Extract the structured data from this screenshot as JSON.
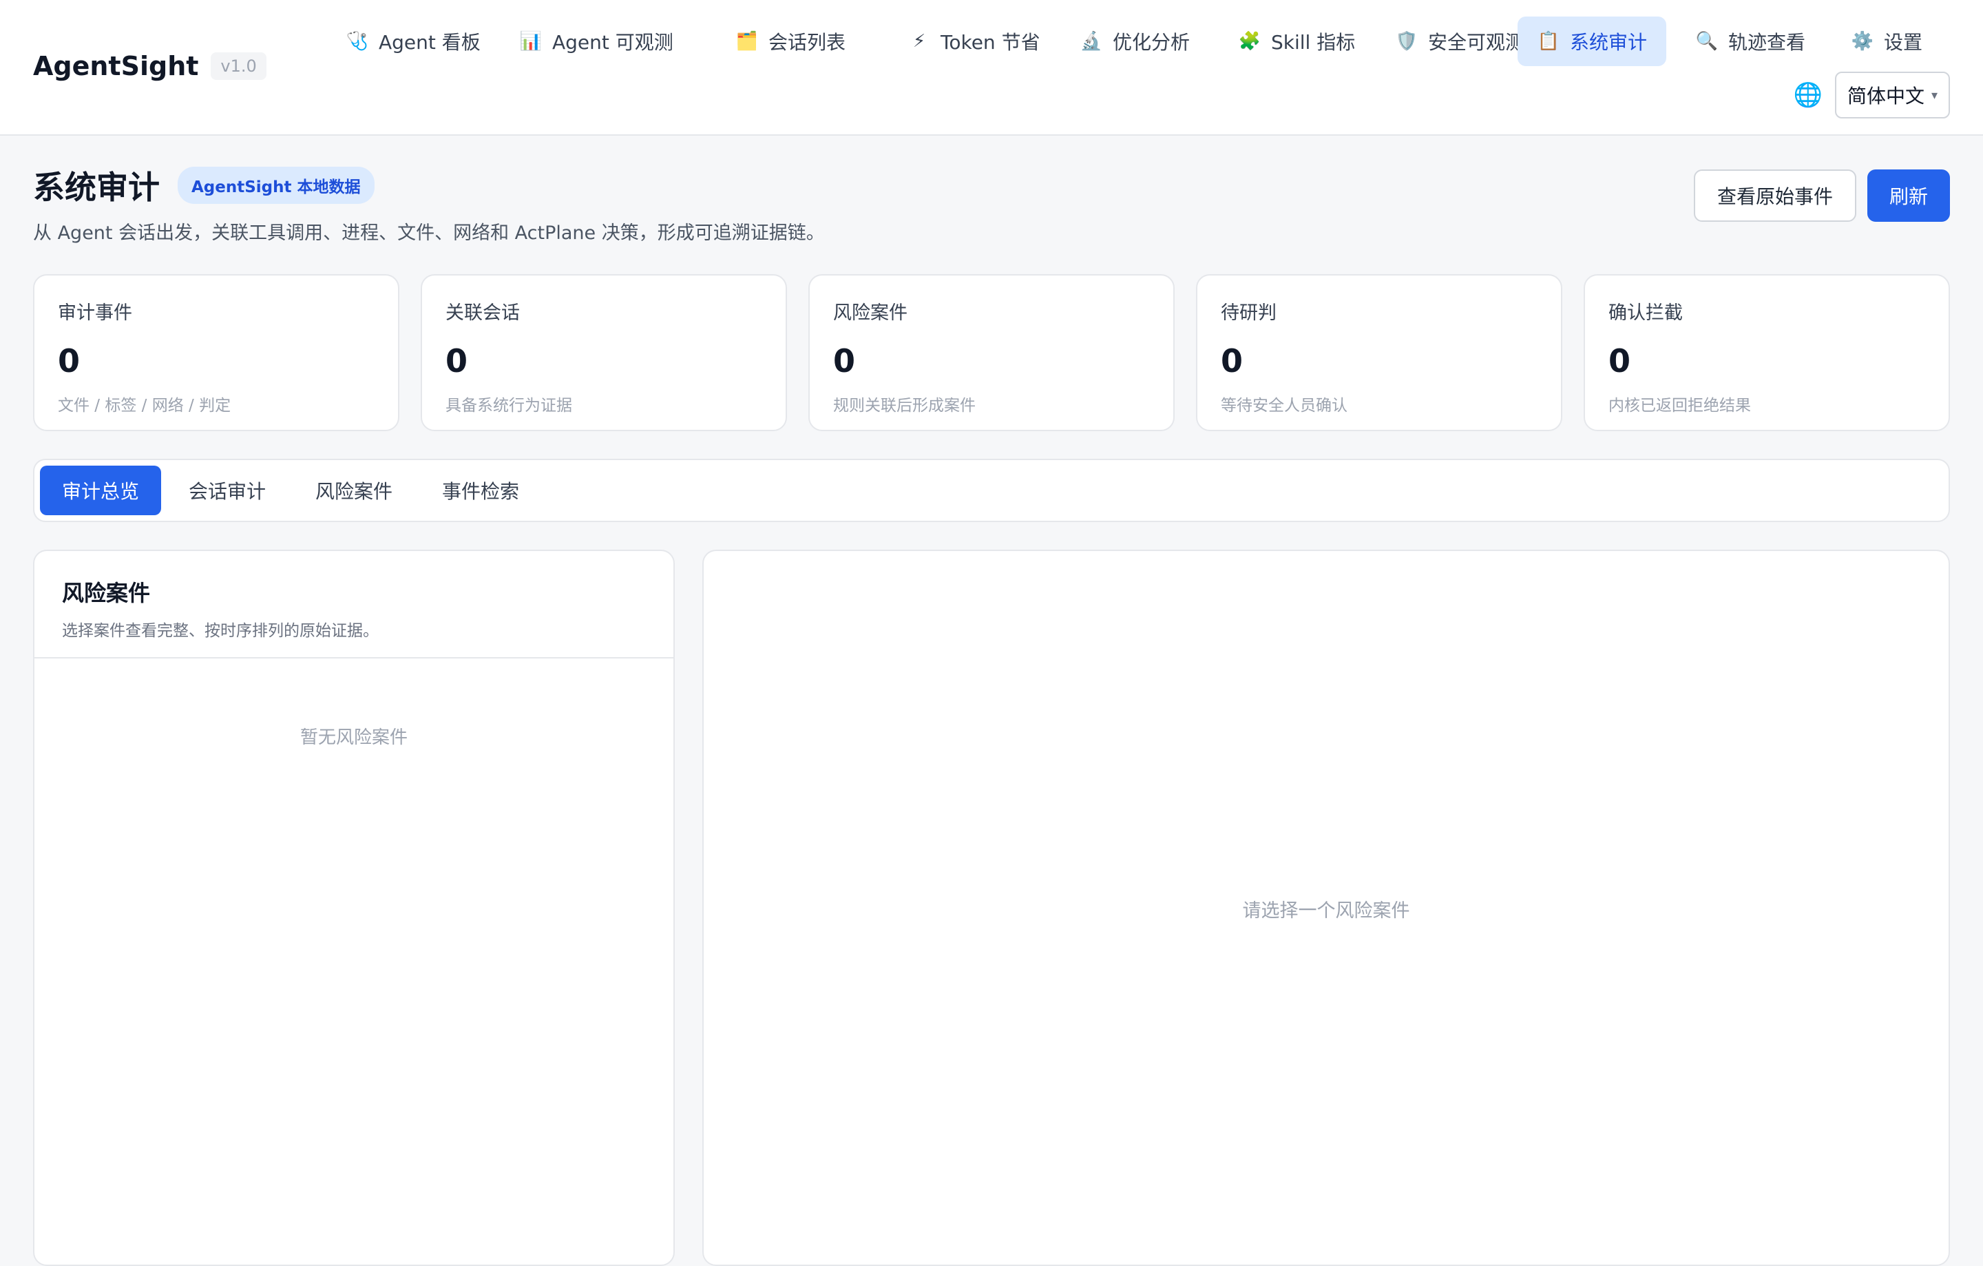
{
  "app": {
    "name": "AgentSight",
    "version": "v1.0"
  },
  "nav": {
    "items": [
      {
        "label": "Agent 看板",
        "icon": "🩺",
        "icon_name": "stethoscope-icon"
      },
      {
        "label": "Agent 可观测",
        "icon": "📊",
        "icon_name": "bar-chart-icon"
      },
      {
        "label": "会话列表",
        "icon": "🗂️",
        "icon_name": "card-index-dividers-icon"
      },
      {
        "label": "Token 节省",
        "icon": "⚡",
        "icon_name": "lightning-icon"
      },
      {
        "label": "优化分析",
        "icon": "🔬",
        "icon_name": "microscope-icon"
      },
      {
        "label": "Skill 指标",
        "icon": "🧩",
        "icon_name": "puzzle-icon"
      },
      {
        "label": "安全可观测",
        "icon": "🛡️",
        "icon_name": "shield-icon"
      },
      {
        "label": "系统审计",
        "icon": "📋",
        "icon_name": "clipboard-icon"
      },
      {
        "label": "轨迹查看",
        "icon": "🔍",
        "icon_name": "magnifier-icon"
      },
      {
        "label": "设置",
        "icon": "⚙️",
        "icon_name": "gear-icon"
      }
    ],
    "active_index": 7
  },
  "language": {
    "icon": "🌐",
    "icon_name": "globe-icon",
    "selected": "简体中文",
    "caret": "▾"
  },
  "page": {
    "title": "系统审计",
    "badge": "AgentSight 本地数据",
    "subtitle": "从 Agent 会话出发，关联工具调用、进程、文件、网络和 ActPlane 决策，形成可追溯证据链。",
    "actions": {
      "raw_events": "查看原始事件",
      "refresh": "刷新"
    }
  },
  "stats": [
    {
      "label": "审计事件",
      "value": "0",
      "desc": "文件 / 标签 / 网络 / 判定"
    },
    {
      "label": "关联会话",
      "value": "0",
      "desc": "具备系统行为证据"
    },
    {
      "label": "风险案件",
      "value": "0",
      "desc": "规则关联后形成案件"
    },
    {
      "label": "待研判",
      "value": "0",
      "desc": "等待安全人员确认"
    },
    {
      "label": "确认拦截",
      "value": "0",
      "desc": "内核已返回拒绝结果"
    }
  ],
  "tabs": {
    "items": [
      "审计总览",
      "会话审计",
      "风险案件",
      "事件检索"
    ],
    "active_index": 0
  },
  "cases_panel": {
    "title": "风险案件",
    "desc": "选择案件查看完整、按时序排列的原始证据。",
    "empty": "暂无风险案件"
  },
  "detail_panel": {
    "empty": "请选择一个风险案件"
  },
  "colors": {
    "accent": "#2563eb",
    "active_nav_bg": "#dbeafe",
    "page_bg": "#f6f7f9",
    "border": "#e5e7eb"
  }
}
